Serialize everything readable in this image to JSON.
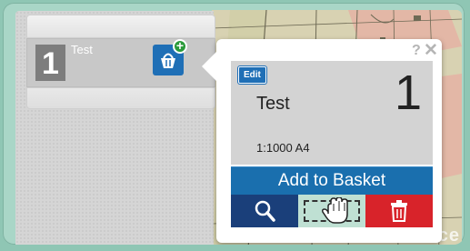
{
  "map": {
    "watermark": "ce"
  },
  "list": {
    "rows": [
      {
        "number": "1",
        "title": "Test"
      }
    ]
  },
  "popup": {
    "help": "?",
    "close": "✕",
    "edit_label": "Edit",
    "title": "Test",
    "number": "1",
    "scale_paper": "1:1000  A4",
    "add_to_basket": "Add to Basket"
  },
  "icons": {
    "basket": "basket-add-icon",
    "search": "search-icon",
    "pan": "hand-pan-icon",
    "delete": "trash-icon"
  },
  "colors": {
    "accent_blue": "#1f6fb6",
    "dark_blue": "#1a3f7a",
    "delete_red": "#d8232a",
    "add_green": "#2b9a3a"
  }
}
